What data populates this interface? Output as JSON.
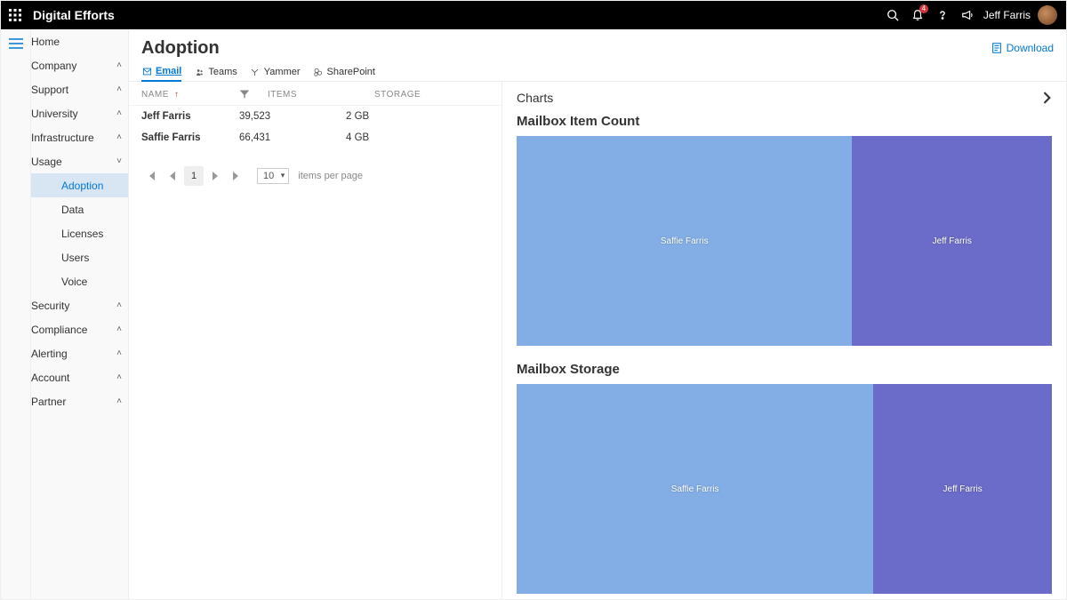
{
  "header": {
    "brand": "Digital Efforts",
    "notification_count": "4",
    "username": "Jeff Farris"
  },
  "sidebar": {
    "items": [
      {
        "label": "Home",
        "icon": "home",
        "expandable": false
      },
      {
        "label": "Company",
        "icon": "building",
        "expandable": true
      },
      {
        "label": "Support",
        "icon": "globe",
        "expandable": true
      },
      {
        "label": "University",
        "icon": "grad",
        "expandable": true
      },
      {
        "label": "Infrastructure",
        "icon": "monitor",
        "expandable": true
      },
      {
        "label": "Usage",
        "icon": "people",
        "expandable": true,
        "expanded": true,
        "children": [
          {
            "label": "Adoption",
            "active": true
          },
          {
            "label": "Data"
          },
          {
            "label": "Licenses"
          },
          {
            "label": "Users"
          },
          {
            "label": "Voice"
          }
        ]
      },
      {
        "label": "Security",
        "icon": "shield",
        "expandable": true
      },
      {
        "label": "Compliance",
        "icon": "warning",
        "expandable": true
      },
      {
        "label": "Alerting",
        "icon": "bell",
        "expandable": true
      },
      {
        "label": "Account",
        "icon": "gear",
        "expandable": true
      },
      {
        "label": "Partner",
        "icon": "partner",
        "expandable": true,
        "class": "partner"
      }
    ]
  },
  "page": {
    "title": "Adoption",
    "download_label": "Download",
    "tabs": [
      {
        "label": "Email",
        "active": true
      },
      {
        "label": "Teams"
      },
      {
        "label": "Yammer"
      },
      {
        "label": "SharePoint"
      }
    ]
  },
  "table": {
    "headers": {
      "name": "NAME",
      "items": "ITEMS",
      "storage": "STORAGE"
    },
    "rows": [
      {
        "name": "Jeff Farris",
        "items": "39,523",
        "storage": "2 GB"
      },
      {
        "name": "Saffie Farris",
        "items": "66,431",
        "storage": "4 GB"
      }
    ],
    "pager": {
      "page": "1",
      "size": "10",
      "size_label": "items per page"
    }
  },
  "charts": {
    "panel_title": "Charts",
    "c1_title": "Mailbox Item Count",
    "c2_title": "Mailbox Storage"
  },
  "chart_data": [
    {
      "type": "treemap",
      "title": "Mailbox Item Count",
      "series": [
        {
          "name": "Saffie Farris",
          "value": 66431,
          "color": "#82aee5"
        },
        {
          "name": "Jeff Farris",
          "value": 39523,
          "color": "#6b6bc9"
        }
      ]
    },
    {
      "type": "treemap",
      "title": "Mailbox Storage",
      "series": [
        {
          "name": "Saffie Farris",
          "value": 4,
          "unit": "GB",
          "color": "#82aee5"
        },
        {
          "name": "Jeff Farris",
          "value": 2,
          "unit": "GB",
          "color": "#6b6bc9"
        }
      ]
    }
  ]
}
